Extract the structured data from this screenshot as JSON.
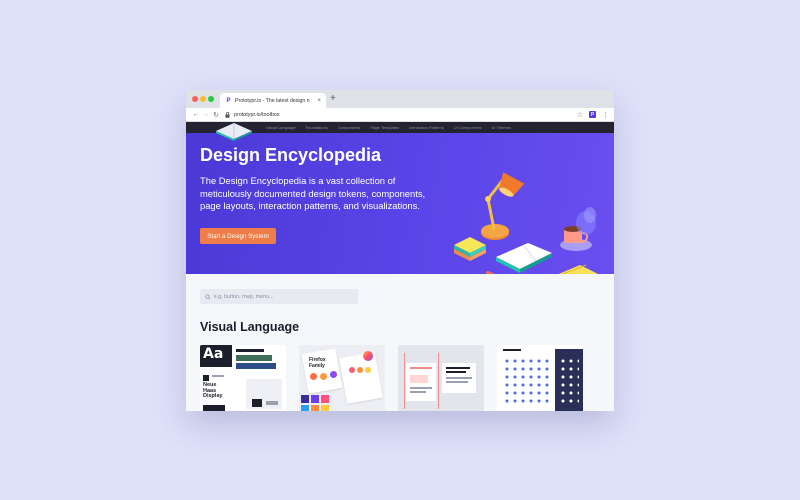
{
  "browser": {
    "tab_title": "Prototypr.io - The latest design n",
    "favicon": "P",
    "close_glyph": "×",
    "new_tab_glyph": "+",
    "url": "prototypr.io/toolbox",
    "ext_label": "P"
  },
  "site_nav": {
    "items": [
      "Visual Language",
      "Foundations",
      "Components",
      "Page Templates",
      "Interaction Patterns",
      "UI Components",
      "Ui Themes"
    ]
  },
  "hero": {
    "title": "Design Encyclopedia",
    "description": "The Design Encyclopedia is a vast collection of meticulously documented design tokens, components, page layouts, interaction patterns, and visualizations.",
    "cta_label": "Start a Design System"
  },
  "search": {
    "placeholder": "e.g. button, map, menu..."
  },
  "section": {
    "title": "Visual Language"
  },
  "cards": {
    "typography": {
      "sample": "Aa",
      "font_name_1": "Neue",
      "font_name_2": "Haas",
      "font_name_3": "Display"
    },
    "color": {
      "label_1": "Firefox",
      "label_2": "Family"
    }
  },
  "colors": {
    "background": "#dfe1fa",
    "hero": "#5a45e8",
    "cta": "#ef7d47",
    "nav_bar": "#232331"
  }
}
